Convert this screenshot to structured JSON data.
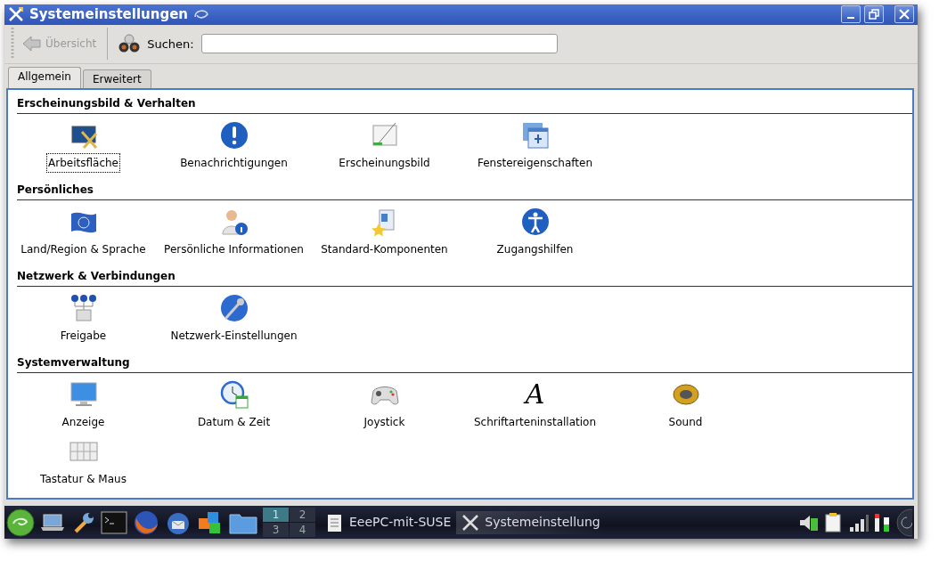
{
  "window": {
    "title": "Systemeinstellungen"
  },
  "toolbar": {
    "back": {
      "label": "Übersicht",
      "disabled": true
    },
    "search": {
      "label": "Suchen:"
    }
  },
  "tabs": [
    {
      "label": "Allgemein",
      "selected": true
    },
    {
      "label": "Erweitert",
      "selected": false
    }
  ],
  "sections": [
    {
      "title": "Erscheinungsbild & Verhalten",
      "items": [
        {
          "label": "Arbeitsfläche",
          "focused": true
        },
        {
          "label": "Benachrichtigungen",
          "focused": false
        },
        {
          "label": "Erscheinungsbild",
          "focused": false
        },
        {
          "label": "Fenstereigenschaften",
          "focused": false
        }
      ]
    },
    {
      "title": "Persönliches",
      "items": [
        {
          "label": "Land/Region & Sprache",
          "focused": false
        },
        {
          "label": "Persönliche Informationen",
          "focused": false
        },
        {
          "label": "Standard-Komponenten",
          "focused": false
        },
        {
          "label": "Zugangshilfen",
          "focused": false
        }
      ]
    },
    {
      "title": "Netzwerk & Verbindungen",
      "items": [
        {
          "label": "Freigabe",
          "focused": false
        },
        {
          "label": "Netzwerk-Einstellungen",
          "focused": false
        }
      ]
    },
    {
      "title": "Systemverwaltung",
      "items": [
        {
          "label": "Anzeige",
          "focused": false
        },
        {
          "label": "Datum & Zeit",
          "focused": false
        },
        {
          "label": "Joystick",
          "focused": false
        },
        {
          "label": "Schriftarteninstallation",
          "focused": false,
          "glyph": "A"
        },
        {
          "label": "Sound",
          "focused": false
        },
        {
          "label": "Tastatur & Maus",
          "focused": false
        }
      ]
    }
  ],
  "taskbar": {
    "pager": [
      {
        "label": "1",
        "selected": true
      },
      {
        "label": "2",
        "selected": false
      },
      {
        "label": "3",
        "selected": false
      },
      {
        "label": "4",
        "selected": false
      }
    ],
    "tasks": [
      {
        "label": "EeePC-mit-SUSE",
        "active": false
      },
      {
        "label": "Systemeinstellung",
        "active": true
      }
    ]
  }
}
